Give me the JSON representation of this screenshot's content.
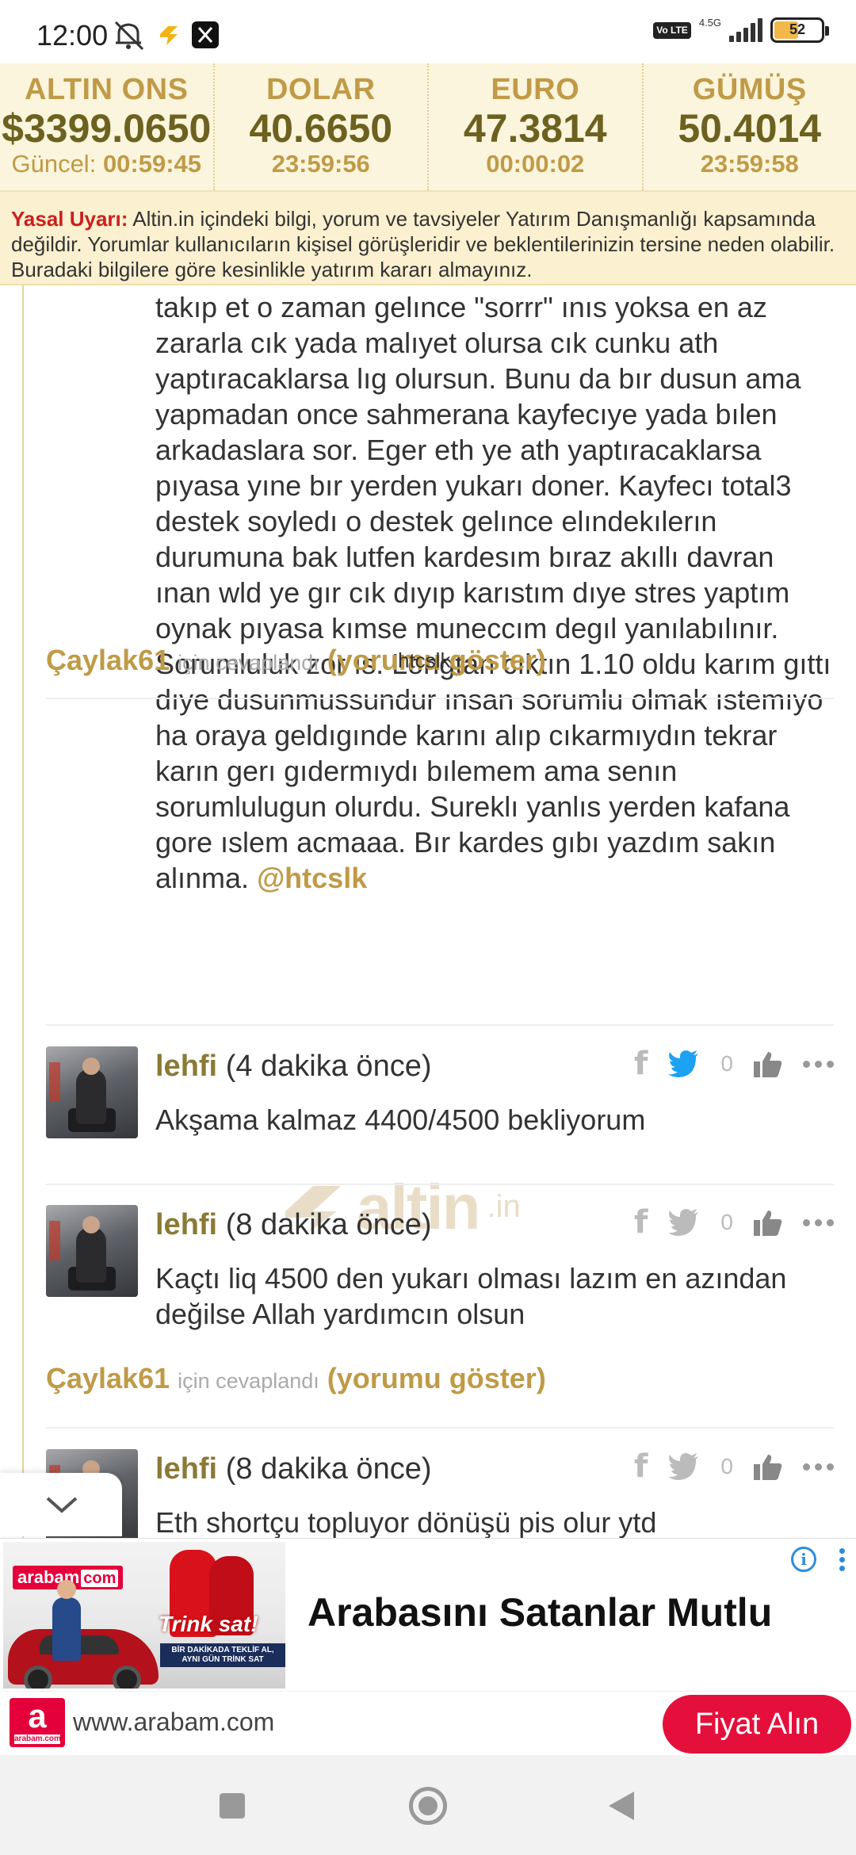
{
  "status_bar": {
    "time": "12:00",
    "network": "4.5G",
    "volte": "Vo LTE",
    "battery": "52"
  },
  "ticker": [
    {
      "name": "ALTIN ONS",
      "value": "$3399.0650",
      "time_label": "Güncel:",
      "time": "00:59:45"
    },
    {
      "name": "DOLAR",
      "value": "40.6650",
      "time_label": "",
      "time": "23:59:56"
    },
    {
      "name": "EURO",
      "value": "47.3814",
      "time_label": "",
      "time": "00:00:02"
    },
    {
      "name": "GÜMÜŞ",
      "value": "50.4014",
      "time_label": "",
      "time": "23:59:58"
    }
  ],
  "disclaimer": {
    "label": "Yasal Uyarı:",
    "text": "Altin.in içindeki bilgi, yorum ve tavsiyeler Yatırım Danışmanlığı kapsamında değildir. Yorumlar kullanıcıların kişisel görüşleridir ve beklentilerinizin tersine neden olabilir. Buradaki bilgilere göre kesinlikle yatırım kararı almayınız."
  },
  "long_comment": {
    "text": "takıp et o zaman gelınce \"sorrr\" ınıs yoksa en az zararla cık yada malıyet olursa cık cunku ath yaptıracaklarsa lıg olursun. Bunu da bır dusun ama yapmadan once sahmerana kayfecıye yada bılen arkadaslara sor. Eger eth ye ath yaptıracaklarsa pıyasa yıne bır yerden yukarı doner. Kayfecı total3 destek soyledı o destek gelınce elındekılerın durumuna bak lutfen kardesım bıraz akıllı davran ınan wld ye gır cık dıyıp karıstım dıye stres yaptım oynak pıyasa kımse muneccım degıl yanılabılınır. Sorumluluk zor ıs. Longtan cıktın 1.10 oldu karım gıttı dıye dusunmussundur ınsan sorumlu olmak ıstemıyo ha oraya geldıgınde karını alıp cıkarmıydın tekrar karın gerı gıdermıydı bılemem ama senın sorumlulugun olurdu. Sureklı yanlıs yerden kafana gore ıslem acmaaa. Bır kardes gıbı yazdım sakın alınma.",
    "mention": "@htcslk"
  },
  "watermark": {
    "brand": "altin",
    "tld": ".in"
  },
  "replies": [
    {
      "user": "Çaylak61",
      "mid": "için cevaplandı",
      "show": "(yorumu göster)",
      "tooltip": "htcslk"
    },
    {
      "user": "Çaylak61",
      "mid": "için cevaplandı",
      "show": "(yorumu göster)",
      "tooltip": ""
    }
  ],
  "comments": [
    {
      "user": "lehfi",
      "time": "(4 dakika önce)",
      "text": "Akşama kalmaz 4400/4500 bekliyorum",
      "likes": "0"
    },
    {
      "user": "lehfi",
      "time": "(8 dakika önce)",
      "text": "Kaçtı liq 4500 den yukarı olması lazım en azından değilse Allah yardımcın olsun",
      "likes": "0"
    },
    {
      "user": "lehfi",
      "time": "(8 dakika önce)",
      "text": "Eth shortçu topluyor dönüşü pis olur ytd",
      "likes": "0"
    }
  ],
  "icons": {
    "facebook": "facebook-icon",
    "twitter": "twitter-icon",
    "like": "thumbs-up-icon",
    "more": "more-dots-icon",
    "collapse": "chevron-down-icon"
  },
  "ad": {
    "headline": "Arabasını Satanlar Mutlu",
    "url": "www.arabam.com",
    "cta": "Fiyat Alın",
    "image_brand": "arabam",
    "image_brand_suffix": "com",
    "image_slogan": "Trink sat!",
    "image_small": "BİR DAKİKADA TEKLİF AL, AYNI GÜN TRİNK SAT",
    "favicon_letter": "a",
    "favicon_text": "arabam.com"
  },
  "colors": {
    "gold": "#c09a47",
    "dark_gold": "#6d6120",
    "warning_red": "#cc1f1f",
    "twitter_blue": "#1da1f2",
    "ad_red": "#e4103b"
  }
}
